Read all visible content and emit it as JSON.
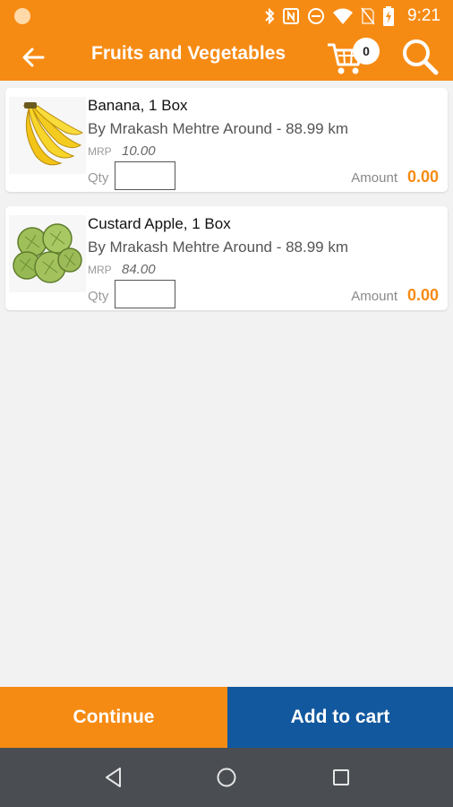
{
  "status_bar": {
    "time": "9:21",
    "icons": [
      "bluetooth-icon",
      "nfc-icon",
      "dnd-icon",
      "wifi-icon",
      "no-sim-icon",
      "battery-charging-icon"
    ]
  },
  "app_bar": {
    "title": "Fruits and Vegetables",
    "cart_count": "0",
    "icons": [
      "back-arrow-icon",
      "cart-icon",
      "search-icon"
    ]
  },
  "products": [
    {
      "name": "Banana, 1 Box",
      "seller": "By Mrakash Mehtre Around - 88.99 km",
      "mrp_label": "MRP",
      "mrp": "10.00",
      "qty_label": "Qty",
      "qty_value": "",
      "amount_label": "Amount",
      "amount": "0.00",
      "image": "banana-image"
    },
    {
      "name": "Custard Apple, 1 Box",
      "seller": "By Mrakash Mehtre Around - 88.99 km",
      "mrp_label": "MRP",
      "mrp": "84.00",
      "qty_label": "Qty",
      "qty_value": "",
      "amount_label": "Amount",
      "amount": "0.00",
      "image": "custard-apple-image"
    }
  ],
  "actions": {
    "continue": "Continue",
    "add_to_cart": "Add to cart"
  },
  "nav_bar": {
    "icons": [
      "nav-back-icon",
      "nav-home-icon",
      "nav-recents-icon"
    ]
  },
  "colors": {
    "primary": "#f68b14",
    "secondary": "#12589e",
    "navbar": "#4a4d52",
    "background": "#f2f2f2"
  }
}
